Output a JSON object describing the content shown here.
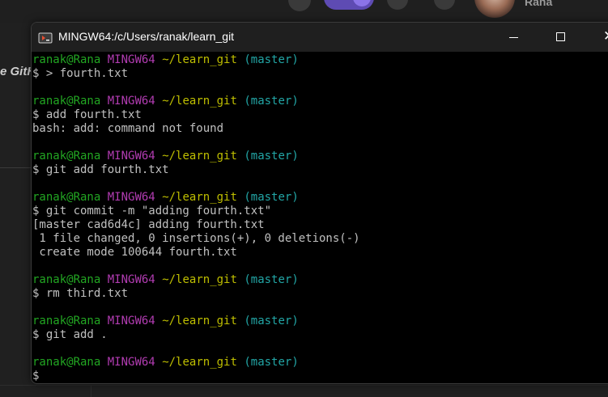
{
  "background": {
    "side_text": "e GitH",
    "username": "Rana"
  },
  "window": {
    "title": "MINGW64:/c/Users/ranak/learn_git",
    "controls": {
      "minimize": "minimize",
      "maximize": "maximize",
      "close": "✕"
    }
  },
  "terminal": {
    "prompt": {
      "user": "ranak@Rana",
      "host": "MINGW64",
      "path": "~/learn_git",
      "branch": "(master)"
    },
    "blocks": [
      {
        "command": "$ > fourth.txt",
        "output": []
      },
      {
        "command": "$ add fourth.txt",
        "output": [
          "bash: add: command not found"
        ]
      },
      {
        "command": "$ git add fourth.txt",
        "output": []
      },
      {
        "command": "$ git commit -m \"adding fourth.txt\"",
        "output": [
          "[master cad6d4c] adding fourth.txt",
          " 1 file changed, 0 insertions(+), 0 deletions(-)",
          " create mode 100644 fourth.txt"
        ]
      },
      {
        "command": "$ rm third.txt",
        "output": []
      },
      {
        "command": "$ git add .",
        "output": []
      },
      {
        "command": "$",
        "output": []
      }
    ]
  },
  "colors": {
    "user": "#22a622",
    "host": "#b23cb2",
    "path": "#bfbf00",
    "branch": "#22a6a6",
    "text": "#c0c0c0"
  }
}
